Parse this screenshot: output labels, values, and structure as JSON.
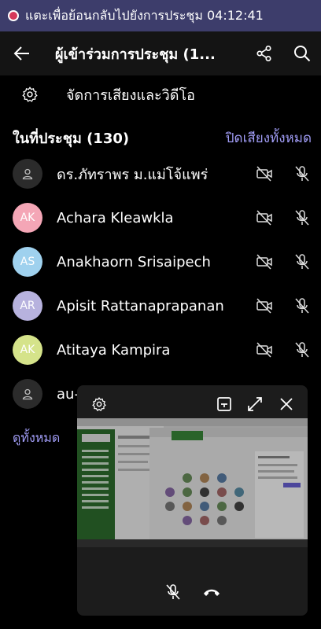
{
  "banner": {
    "text": "แตะเพื่อย้อนกลับไปยังการประชุม 04:12:41"
  },
  "header": {
    "title": "ผู้เข้าร่วมการประชุม (1..."
  },
  "av_settings": {
    "label": "จัดการเสียงและวิดีโอ"
  },
  "section": {
    "title": "ในที่ประชุม (130)",
    "mute_all": "ปิดเสียงทั้งหมด"
  },
  "participants": [
    {
      "name": "ดร.ภัทราพร ม.แม่โจ้แพร่",
      "initials": "",
      "color": "#2b2b2b"
    },
    {
      "name": "Achara Kleawkla",
      "initials": "AK",
      "color": "#f4a6b6"
    },
    {
      "name": "Anakhaorn Srisaipech",
      "initials": "AS",
      "color": "#9fd1ee"
    },
    {
      "name": "Apisit Rattanaprapanan",
      "initials": "AR",
      "color": "#b7b2de"
    },
    {
      "name": "Atitaya Kampira",
      "initials": "AK",
      "color": "#d5e38a"
    },
    {
      "name": "au-",
      "initials": "",
      "color": "#2b2b2b"
    }
  ],
  "view_all": "ดูทั้งหมด",
  "colors": {
    "accent": "#a09cf5",
    "banner": "#3d3d6b",
    "record": "#d6385a"
  }
}
